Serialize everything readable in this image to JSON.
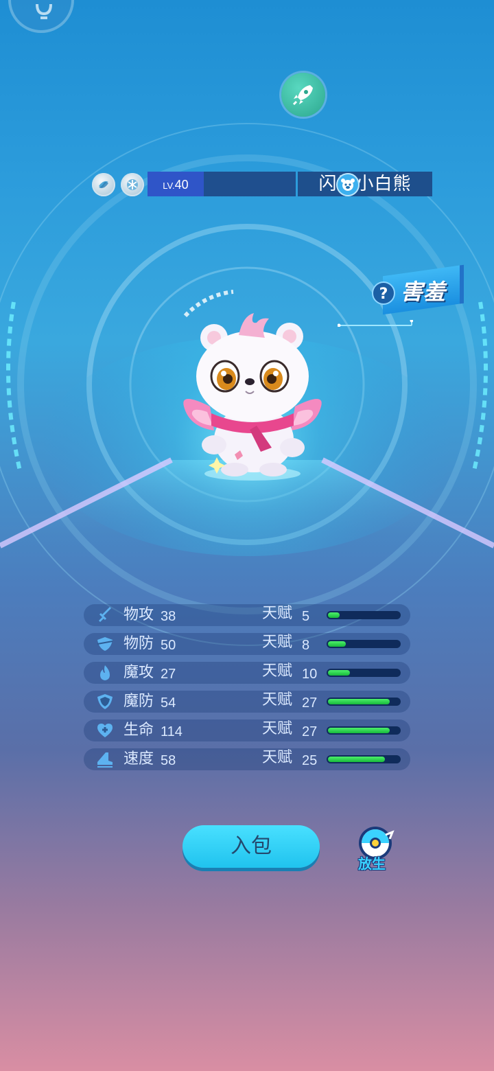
{
  "pet": {
    "level_prefix": "LV.",
    "level": "40",
    "name": "闪光小白熊",
    "trait": "害羞",
    "trait_help": "?"
  },
  "stats": [
    {
      "key": "attack",
      "label": "物攻",
      "value": "38",
      "talent_label": "天赋",
      "talent": "5",
      "talent_fraction": 0.16
    },
    {
      "key": "defense",
      "label": "物防",
      "value": "50",
      "talent_label": "天赋",
      "talent": "8",
      "talent_fraction": 0.25
    },
    {
      "key": "magic-attack",
      "label": "魔攻",
      "value": "27",
      "talent_label": "天赋",
      "talent": "10",
      "talent_fraction": 0.31
    },
    {
      "key": "magic-defense",
      "label": "魔防",
      "value": "54",
      "talent_label": "天赋",
      "talent": "27",
      "talent_fraction": 0.87
    },
    {
      "key": "hp",
      "label": "生命",
      "value": "114",
      "talent_label": "天赋",
      "talent": "27",
      "talent_fraction": 0.87
    },
    {
      "key": "speed",
      "label": "速度",
      "value": "58",
      "talent_label": "天赋",
      "talent": "25",
      "talent_fraction": 0.8
    }
  ],
  "actions": {
    "bag_label": "入包",
    "release_label": "放生"
  },
  "icons": {
    "top_left": "lightbulb-icon",
    "rocket": "rocket-icon",
    "badge1": "element-badge-icon",
    "badge2": "snowflake-badge-icon",
    "gender": "pet-face-icon"
  },
  "colors": {
    "bar_fill": "#2bd14a",
    "bar_track": "#0f2b5b",
    "button": "#2bc8f0"
  }
}
